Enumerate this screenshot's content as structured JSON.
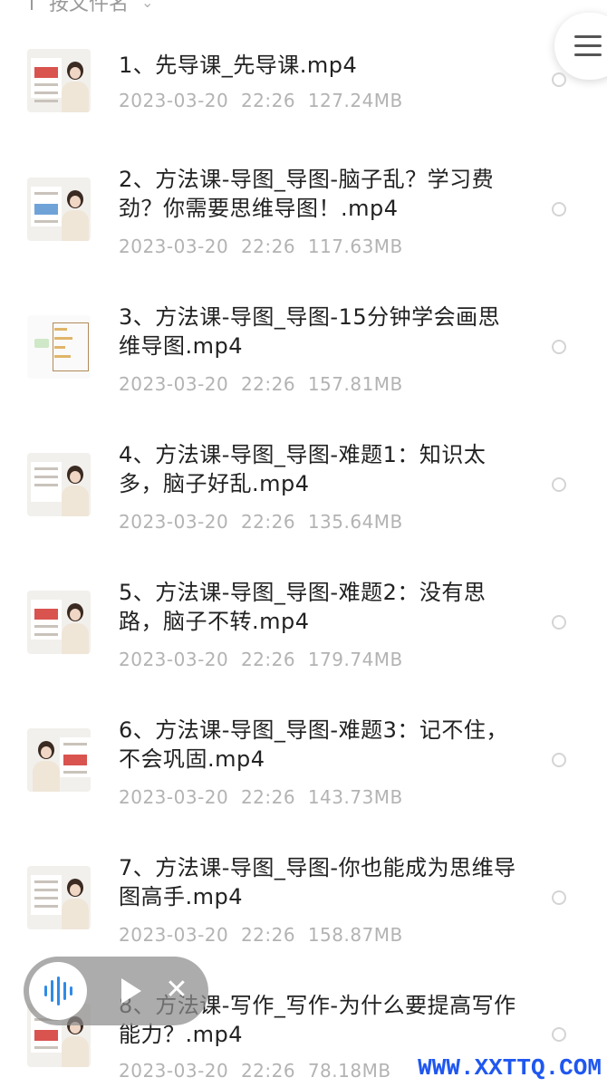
{
  "sort_bar": {
    "label": "按文件名",
    "caret": "⌄"
  },
  "icons": {
    "grid": "grid-view-icon",
    "menu": "hamburger-menu-icon",
    "audio": "audio-waveform-icon",
    "play": "play-icon",
    "close": "close-icon"
  },
  "files": [
    {
      "name": "1、先导课_先导课.mp4",
      "date": "2023-03-20  22:26",
      "size": "127.24MB"
    },
    {
      "name": "2、方法课-导图_导图-脑子乱？学习费劲？你需要思维导图！.mp4",
      "date": "2023-03-20  22:26",
      "size": "117.63MB"
    },
    {
      "name": "3、方法课-导图_导图-15分钟学会画思维导图.mp4",
      "date": "2023-03-20  22:26",
      "size": "157.81MB"
    },
    {
      "name": "4、方法课-导图_导图-难题1：知识太多，脑子好乱.mp4",
      "date": "2023-03-20  22:26",
      "size": "135.64MB"
    },
    {
      "name": "5、方法课-导图_导图-难题2：没有思路，脑子不转.mp4",
      "date": "2023-03-20  22:26",
      "size": "179.74MB"
    },
    {
      "name": "6、方法课-导图_导图-难题3：记不住，不会巩固.mp4",
      "date": "2023-03-20  22:26",
      "size": "143.73MB"
    },
    {
      "name": "7、方法课-导图_导图-你也能成为思维导图高手.mp4",
      "date": "2023-03-20  22:26",
      "size": "158.87MB"
    },
    {
      "name": "8、方法课-写作_写作-为什么要提高写作能力？.mp4",
      "date": "2023-03-20  22:26",
      "size": "78.18MB"
    }
  ],
  "watermark": "WWW.XXTTQ.COM"
}
